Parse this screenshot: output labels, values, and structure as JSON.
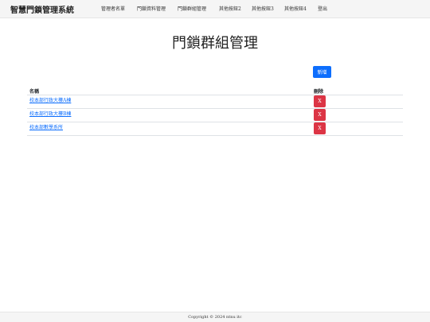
{
  "navbar": {
    "brand": "智慧門鎖管理系統",
    "items": [
      {
        "label": "管理者名單"
      },
      {
        "label": "門鎖資料管理"
      },
      {
        "label": "門鎖群組管理"
      },
      {
        "label": "其他按鈕2"
      },
      {
        "label": "其他按鈕3"
      },
      {
        "label": "其他按鈕4"
      },
      {
        "label": "登出"
      }
    ]
  },
  "main": {
    "title": "門鎖群組管理",
    "add_label": "新增",
    "columns": [
      "名稱",
      "刪除"
    ],
    "rows": [
      {
        "name": "校本部行政大樓A棟",
        "delete_label": "X"
      },
      {
        "name": "校本部行政大樓B棟",
        "delete_label": "X"
      },
      {
        "name": "校本部數學系所",
        "delete_label": "X"
      }
    ]
  },
  "footer": {
    "text": "Copyright © 2024 ntnu itc"
  },
  "colors": {
    "primary": "#0d6efd",
    "danger": "#dc3545",
    "navbar_bg": "#f5f5f5"
  }
}
